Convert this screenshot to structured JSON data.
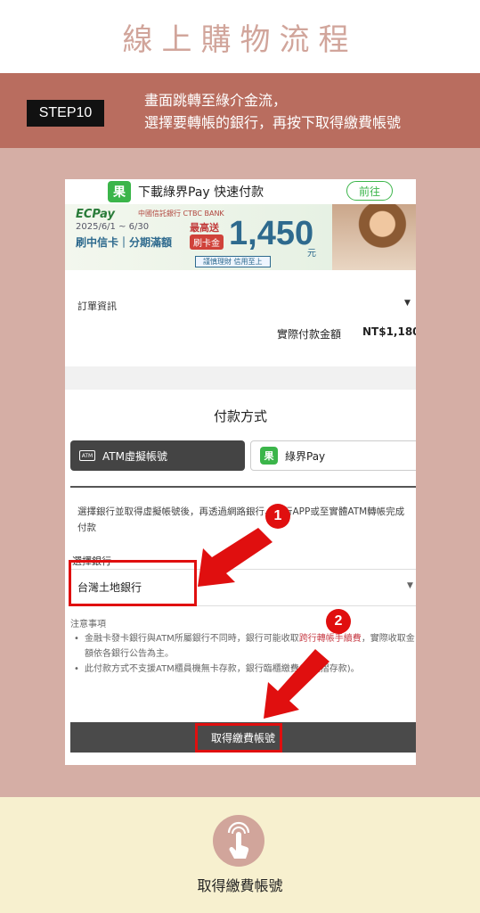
{
  "header": {
    "title": "線上購物流程"
  },
  "step": {
    "badge": "STEP10",
    "line1": "畫面跳轉至綠介金流，",
    "line2": "選擇要轉帳的銀行，再按下取得繳費帳號"
  },
  "ecpay_bar": {
    "logo": "果",
    "text": "下載綠界Pay 快速付款",
    "go_label": "前往"
  },
  "banner": {
    "brand": "ECPay",
    "bank": "中國信託銀行 CTBC BANK",
    "date": "2025/6/1 ~ 6/30",
    "sub": "刷中信卡｜分期滿額",
    "max": "最高送",
    "gold": "刷卡金",
    "amount": "1,450",
    "yuan": "元",
    "tag": "謹慎理財 信用至上"
  },
  "order": {
    "label": "訂單資訊",
    "arrow": "▼",
    "paid_label": "實際付款金額",
    "paid_value": "NT$1,180"
  },
  "payment": {
    "title": "付款方式",
    "tabs": [
      {
        "label": "ATM虛擬帳號",
        "icon": "ATM"
      },
      {
        "label": "綠界Pay",
        "icon": "果"
      }
    ],
    "description": "選擇銀行並取得虛擬帳號後，再透過網路銀行、銀行APP或至實體ATM轉帳完成付款",
    "bank_label": "選擇銀行",
    "bank_value": "台灣土地銀行",
    "bank_caret": "▼",
    "notes_title": "注意事項",
    "note1_a": "金融卡發卡銀行與ATM所屬銀行不同時，銀行可能收取",
    "note1_red": "跨行轉帳手續費",
    "note1_b": "，實際收取金額依各銀行公告為主。",
    "note2": "此付款方式不支援ATM櫃員機無卡存款，銀行臨櫃繳費(含無摺存款)。",
    "get_button": "取得繳費帳號"
  },
  "annotations": {
    "num1": "1",
    "num2": "2",
    "color": "#e00f0f"
  },
  "bottom": {
    "label": "取得繳費帳號",
    "icon": "tap-hand-icon"
  }
}
